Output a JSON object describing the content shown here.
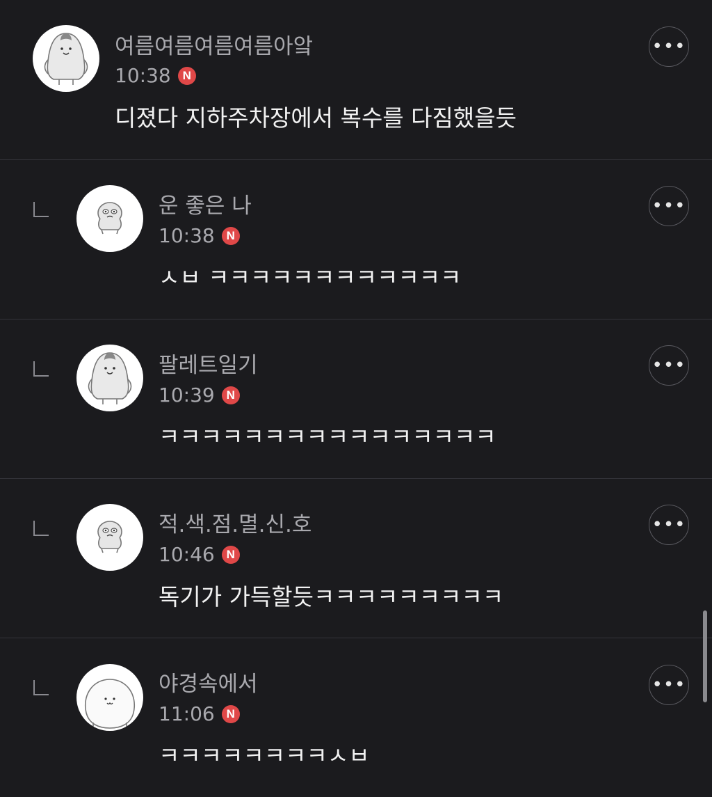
{
  "comments": [
    {
      "nickname": "여름여름여름여름아앜",
      "time": "10:38",
      "badge": "N",
      "text": "디졌다 지하주차장에서 복수를 다짐했을듯",
      "avatar_icon": "penguin-icon",
      "is_reply": false
    },
    {
      "nickname": "운 좋은 나",
      "time": "10:38",
      "badge": "N",
      "text": "ㅅㅂ ㅋㅋㅋㅋㅋㅋㅋㅋㅋㅋㅋㅋ",
      "avatar_icon": "seal-icon",
      "is_reply": true
    },
    {
      "nickname": "팔레트일기",
      "time": "10:39",
      "badge": "N",
      "text": "ㅋㅋㅋㅋㅋㅋㅋㅋㅋㅋㅋㅋㅋㅋㅋㅋ",
      "avatar_icon": "penguin-icon",
      "is_reply": true
    },
    {
      "nickname": "적.색.점.멸.신.호",
      "time": "10:46",
      "badge": "N",
      "text": "독기가 가득할듯ㅋㅋㅋㅋㅋㅋㅋㅋㅋ",
      "avatar_icon": "seal-icon",
      "is_reply": true
    },
    {
      "nickname": "야경속에서",
      "time": "11:06",
      "badge": "N",
      "text": "ㅋㅋㅋㅋㅋㅋㅋㅋㅅㅂ",
      "avatar_icon": "blob-icon",
      "is_reply": true
    }
  ],
  "more_button_label": "•••",
  "colors": {
    "background": "#1b1b1e",
    "divider": "#34343a",
    "badge": "#e04848",
    "nickname": "#a9a9ae"
  }
}
